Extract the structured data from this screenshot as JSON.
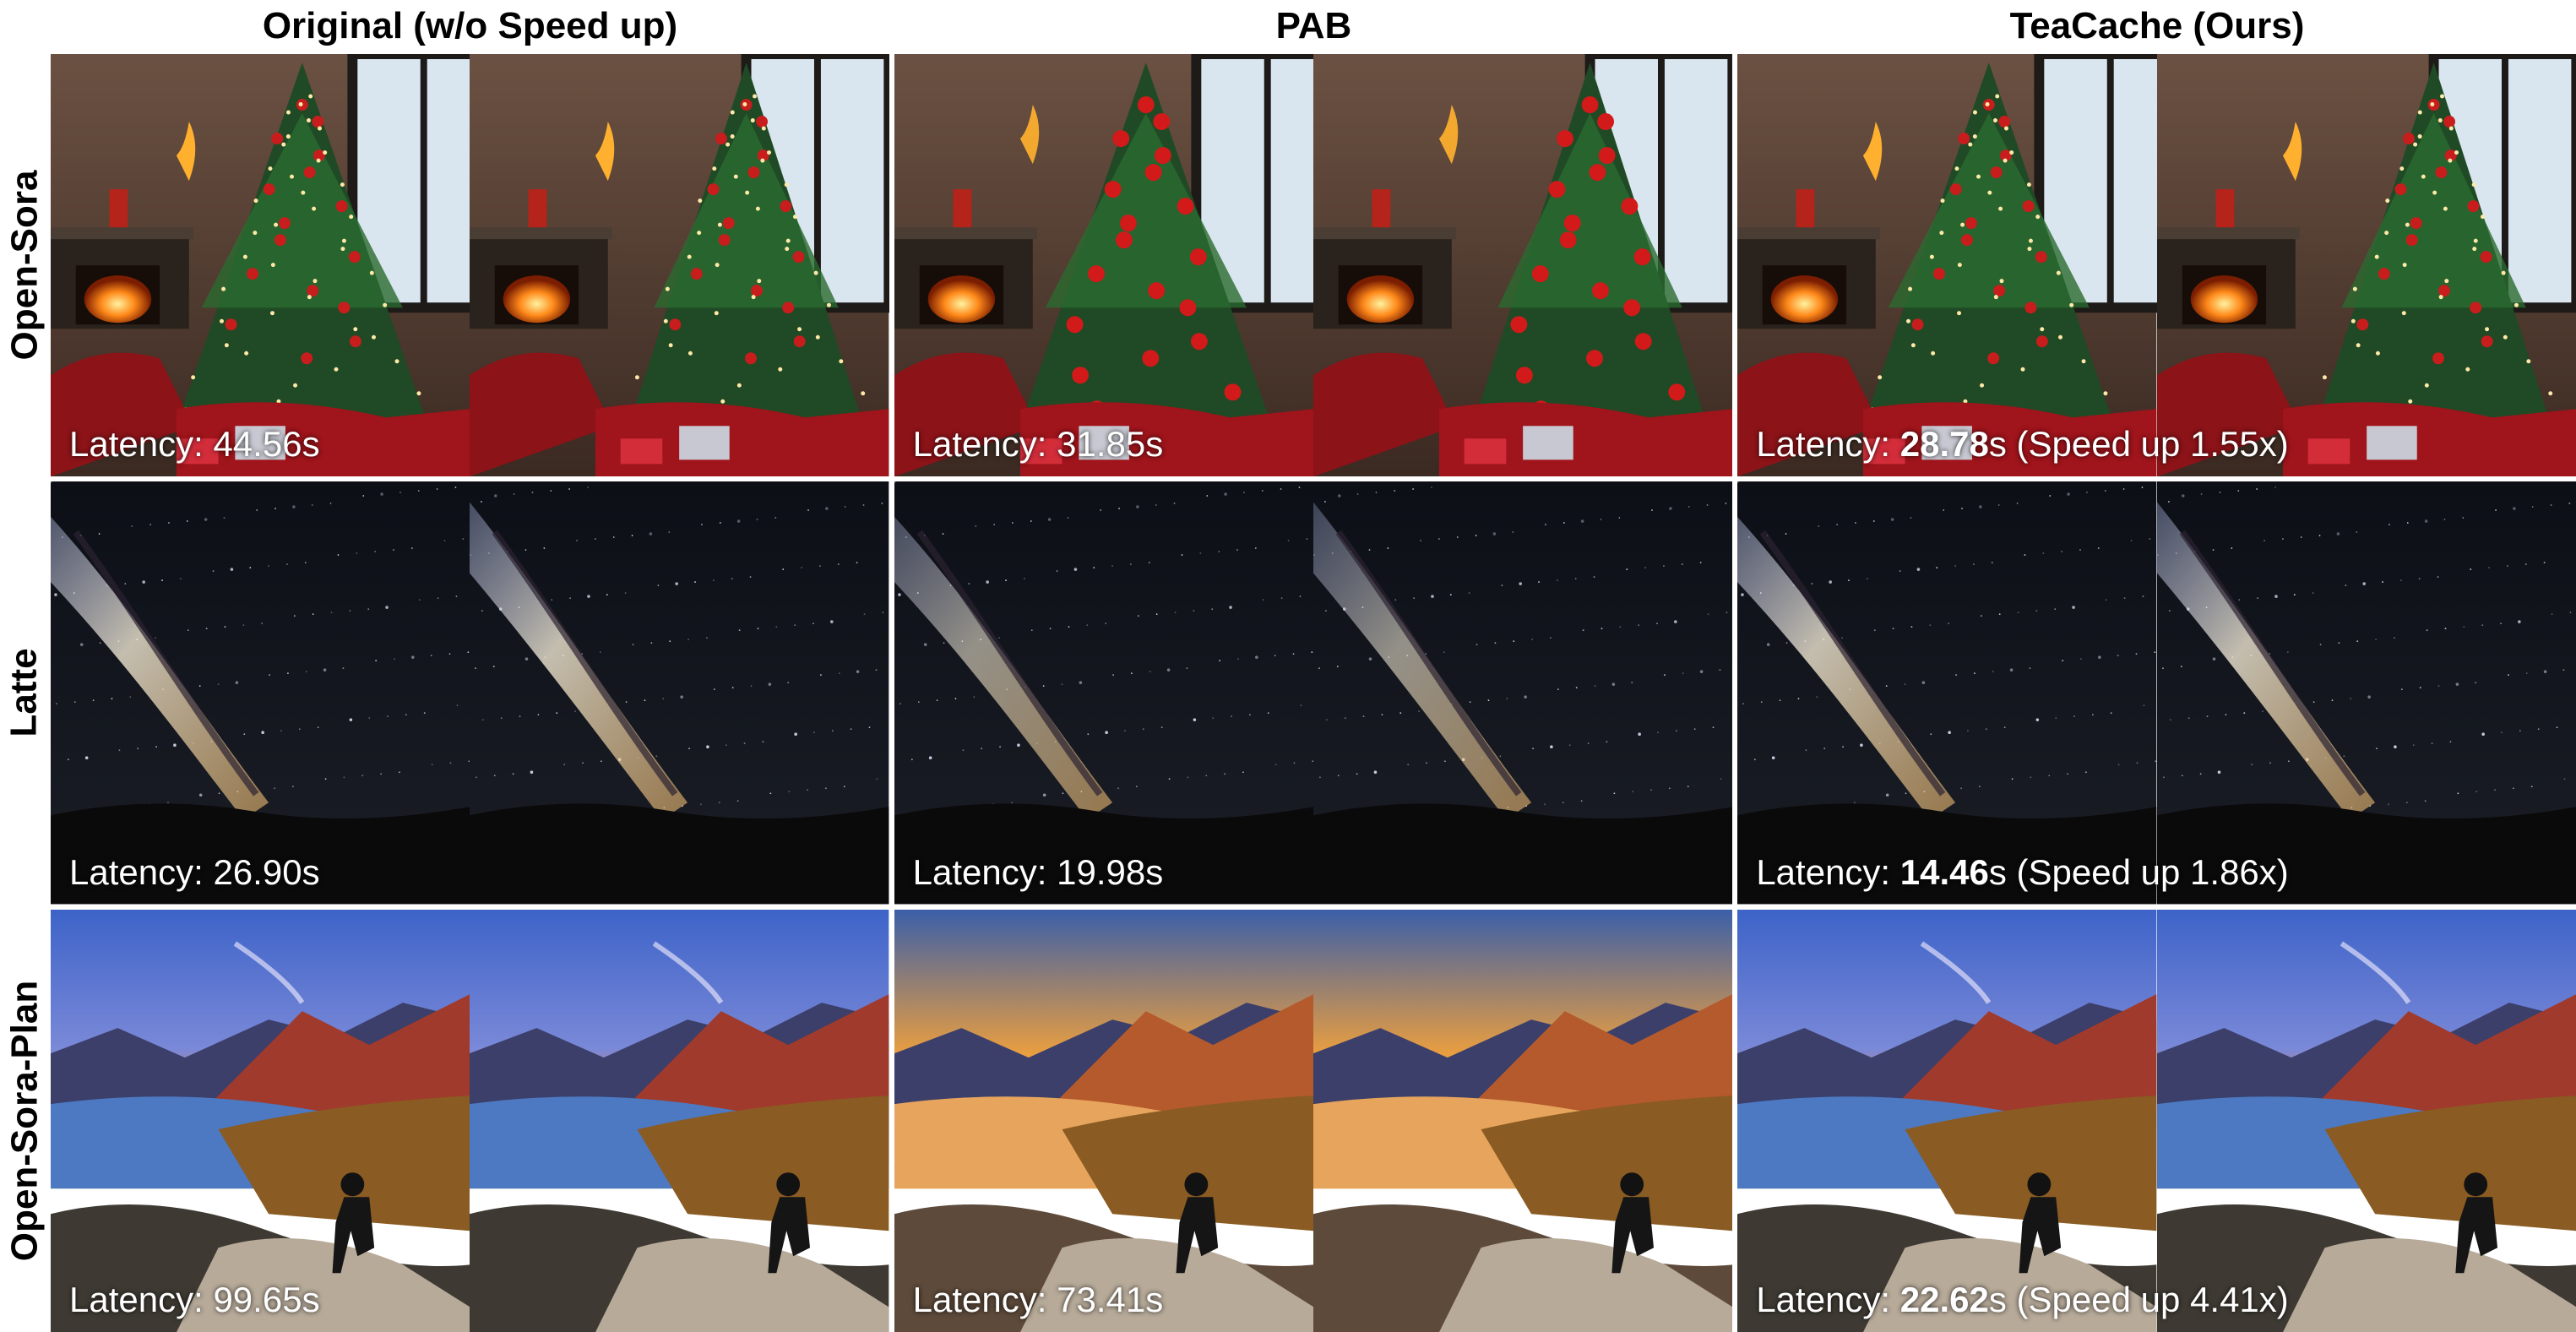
{
  "columns": [
    "Original (w/o Speed up)",
    "PAB",
    "TeaCache (Ours)"
  ],
  "rows": [
    {
      "label": "Open-Sora",
      "scene": "christmas-living-room",
      "latency": [
        {
          "prefix": "Latency: ",
          "value": "44.56",
          "suffix": "s",
          "bold": false
        },
        {
          "prefix": "Latency: ",
          "value": "31.85",
          "suffix": "s",
          "bold": false
        },
        {
          "prefix": "Latency: ",
          "value": "28.78",
          "suffix": "s (Speed up 1.55x)",
          "bold": true
        }
      ]
    },
    {
      "label": "Latte",
      "scene": "milky-way-night-sky",
      "latency": [
        {
          "prefix": "Latency: ",
          "value": "26.90",
          "suffix": "s",
          "bold": false
        },
        {
          "prefix": "Latency: ",
          "value": "19.98",
          "suffix": "s",
          "bold": false
        },
        {
          "prefix": "Latency: ",
          "value": "14.46",
          "suffix": "s (Speed up 1.86x)",
          "bold": true
        }
      ]
    },
    {
      "label": "Open-Sora-Plan",
      "scene": "mountain-lake-sunset",
      "latency": [
        {
          "prefix": "Latency: ",
          "value": "99.65",
          "suffix": "s",
          "bold": false
        },
        {
          "prefix": "Latency: ",
          "value": "73.41",
          "suffix": "s",
          "bold": false
        },
        {
          "prefix": "Latency: ",
          "value": "22.62",
          "suffix": "s (Speed up 4.41x)",
          "bold": true
        }
      ]
    }
  ]
}
